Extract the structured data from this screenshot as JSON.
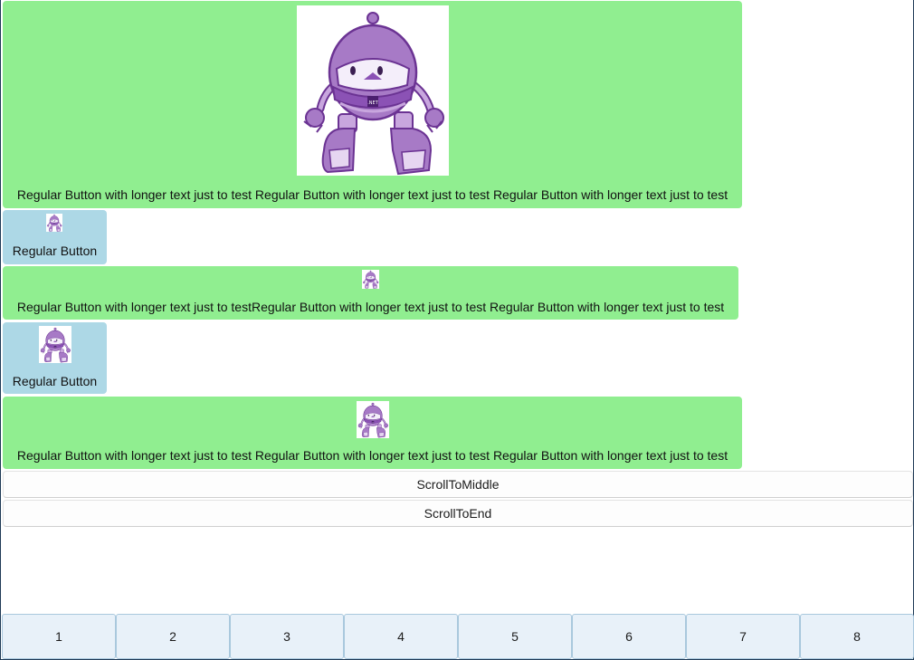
{
  "buttons": [
    {
      "label": "Regular Button with longer text just to test Regular Button with longer text just to test Regular Button with longer text just to test",
      "color": "#90ee90"
    },
    {
      "label": "Regular Button",
      "color": "#add8e6"
    },
    {
      "label": "Regular Button with longer text just to testRegular Button with longer text just to test Regular Button with longer text just to test",
      "color": "#90ee90"
    },
    {
      "label": "Regular Button",
      "color": "#add8e6"
    },
    {
      "label": "Regular Button with longer text just to test Regular Button with longer text just to test Regular Button with longer text just to test",
      "color": "#90ee90"
    }
  ],
  "robot_image": {
    "icon": "dotnet-bot-icon",
    "badge": ".NET",
    "primary_color": "#a77ac6"
  },
  "scroll": {
    "middle_label": "ScrollToMiddle",
    "end_label": "ScrollToEnd"
  },
  "tabs": [
    "1",
    "2",
    "3",
    "4",
    "5",
    "6",
    "7",
    "8"
  ]
}
